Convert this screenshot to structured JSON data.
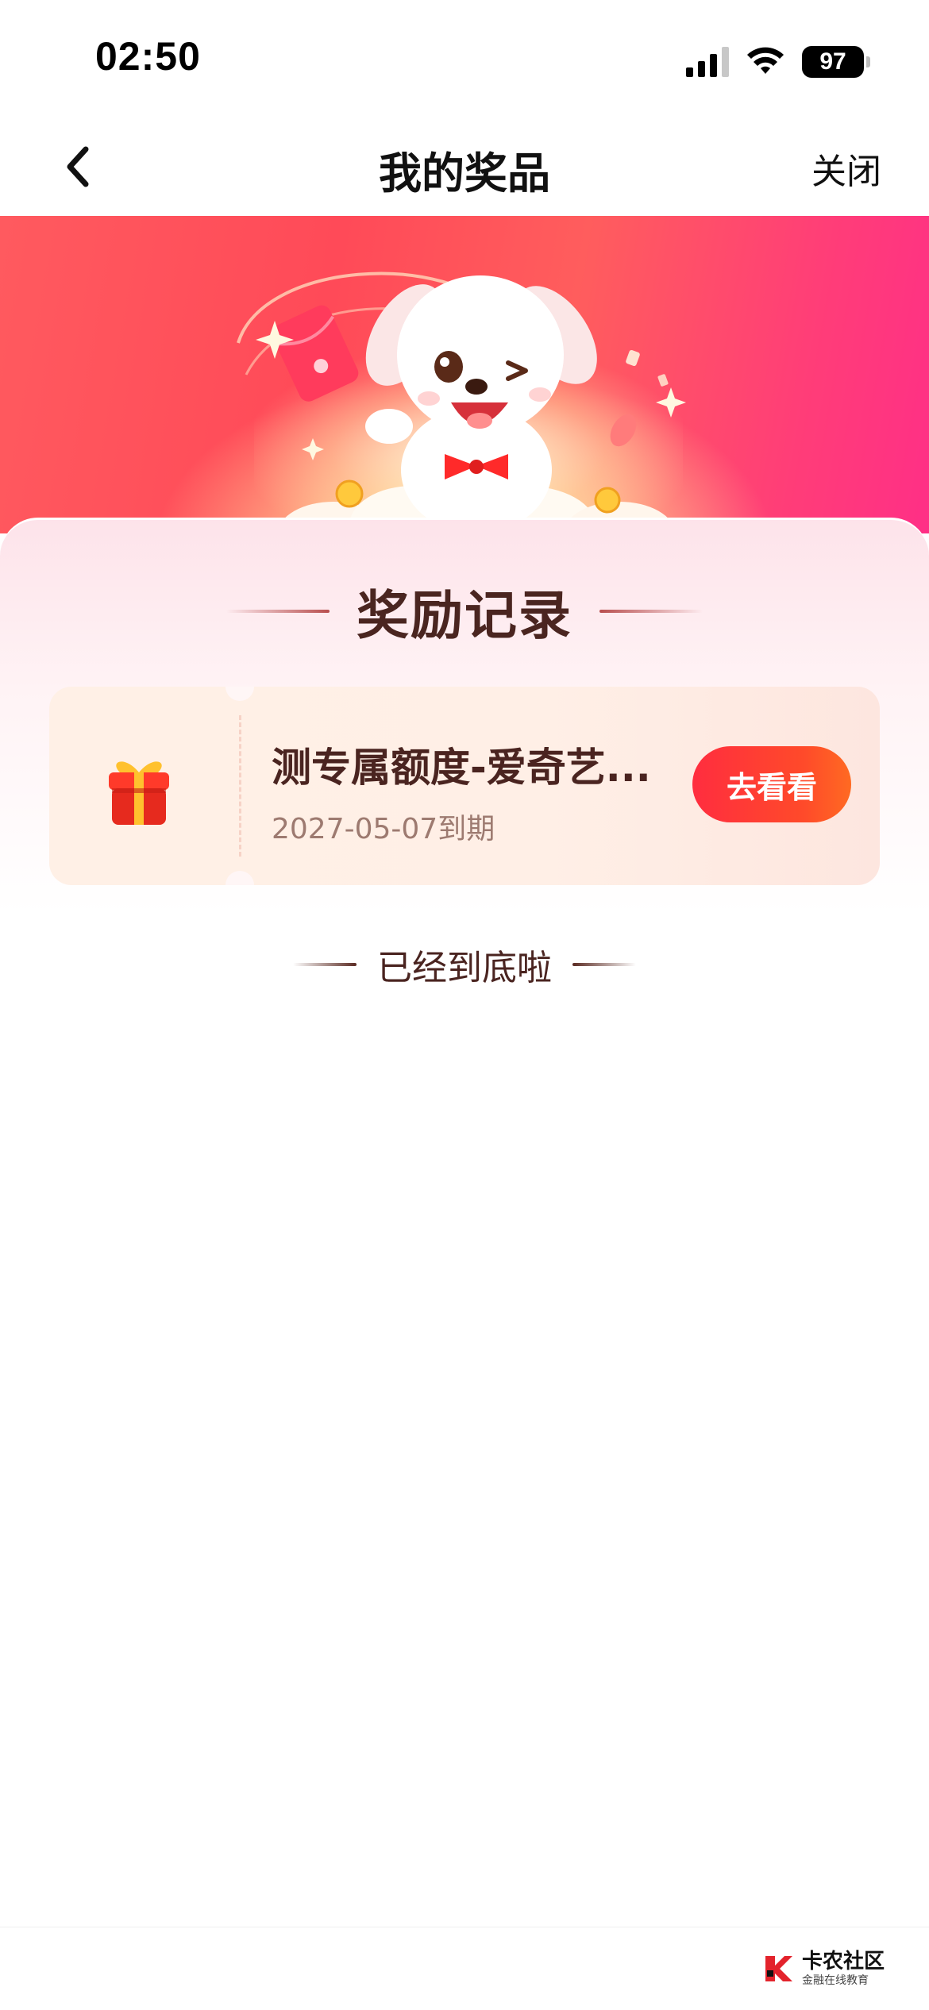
{
  "status_bar": {
    "time": "02:50",
    "battery": "97"
  },
  "nav": {
    "title": "我的奖品",
    "close_label": "关闭"
  },
  "section": {
    "title": "奖励记录"
  },
  "rewards": [
    {
      "name": "测专属额度-爱奇艺...",
      "expiry": "2027-05-07到期",
      "action_label": "去看看"
    }
  ],
  "end_text": "已经到底啦",
  "footer": {
    "logo_main": "卡农社区",
    "logo_sub": "金融在线教育"
  },
  "colors": {
    "accent": "#ff3a3a",
    "title_brown": "#4a2520",
    "banner_pink": "#ff3d78"
  },
  "icons": [
    "back-chevron-icon",
    "signal-icon",
    "wifi-icon",
    "battery-icon",
    "gift-icon",
    "mascot-dog",
    "red-envelope-icon",
    "logo-icon"
  ]
}
